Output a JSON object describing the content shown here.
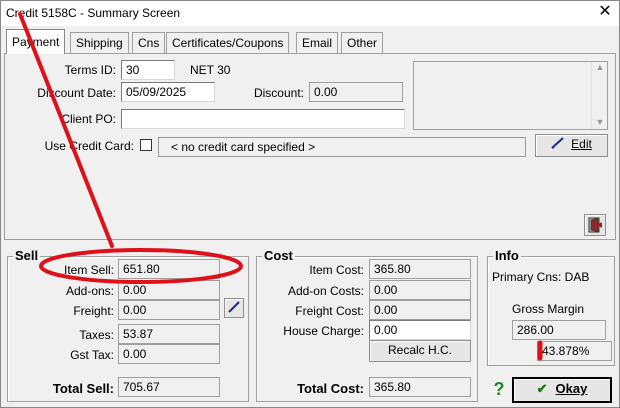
{
  "window": {
    "title": "Credit 5158C - Summary Screen",
    "close_glyph": "✕"
  },
  "tabs": [
    {
      "label": "Payment",
      "active": true
    },
    {
      "label": "Shipping"
    },
    {
      "label": "Cns"
    },
    {
      "label": "Certificates/Coupons"
    },
    {
      "label": "Email"
    },
    {
      "label": "Other"
    }
  ],
  "payment": {
    "terms_id_label": "Terms ID:",
    "terms_id_value": "30",
    "terms_desc": "NET 30",
    "discount_date_label": "Discount Date:",
    "discount_date_value": "05/09/2025",
    "discount_label": "Discount:",
    "discount_value": "0.00",
    "client_po_label": "Client PO:",
    "client_po_value": "",
    "use_credit_card_label": "Use Credit Card:",
    "use_credit_card_checked": false,
    "credit_card_text": "< no credit card specified >",
    "edit_label": "Edit"
  },
  "sell": {
    "title": "Sell",
    "item_sell_label": "Item Sell:",
    "item_sell_value": "651.80",
    "addons_label": "Add-ons:",
    "addons_value": "0.00",
    "freight_label": "Freight:",
    "freight_value": "0.00",
    "taxes_label": "Taxes:",
    "taxes_value": "53.87",
    "gst_tax_label": "Gst Tax:",
    "gst_tax_value": "0.00",
    "total_label": "Total Sell:",
    "total_value": "705.67"
  },
  "cost": {
    "title": "Cost",
    "item_cost_label": "Item Cost:",
    "item_cost_value": "365.80",
    "addon_costs_label": "Add-on Costs:",
    "addon_costs_value": "0.00",
    "freight_cost_label": "Freight Cost:",
    "freight_cost_value": "0.00",
    "house_charge_label": "House Charge:",
    "house_charge_value": "0.00",
    "recalc_label": "Recalc H.C.",
    "total_label": "Total Cost:",
    "total_value": "365.80"
  },
  "info": {
    "title": "Info",
    "primary_cns": "Primary Cns: DAB",
    "gross_margin_label": "Gross Margin",
    "gross_margin_value": "286.00",
    "gross_margin_pct": "43.878%"
  },
  "footer": {
    "help_glyph": "?",
    "okay_label": "Okay",
    "check_glyph": "✔"
  },
  "colors": {
    "annotation_red": "#e0101a",
    "help_green": "#1a8a1a",
    "check_green": "#1a7a1a"
  }
}
